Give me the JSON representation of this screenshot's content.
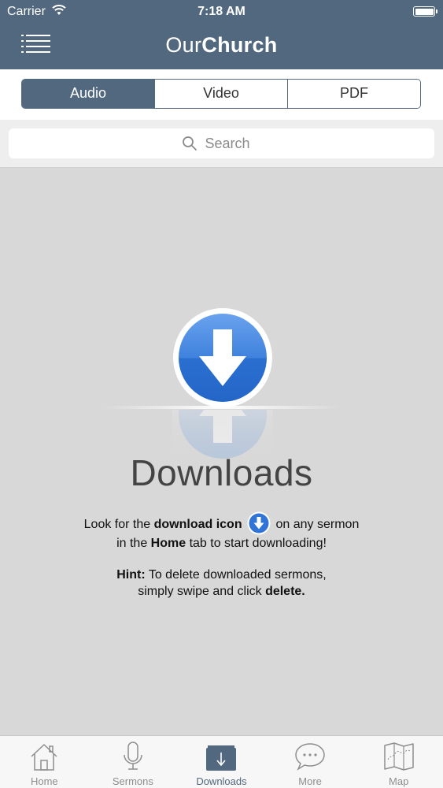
{
  "status_bar": {
    "carrier": "Carrier",
    "time": "7:18 AM"
  },
  "header": {
    "brand_light": "Our",
    "brand_bold": "Church"
  },
  "segments": [
    {
      "label": "Audio",
      "active": true
    },
    {
      "label": "Video",
      "active": false
    },
    {
      "label": "PDF",
      "active": false
    }
  ],
  "search": {
    "placeholder": "Search"
  },
  "empty_state": {
    "title": "Downloads",
    "line1_pre": "Look for the ",
    "line1_bold": "download icon",
    "line1_post": " on any sermon",
    "line2_pre": "in the ",
    "line2_bold": "Home",
    "line2_post": " tab to start downloading!",
    "hint_label": "Hint:",
    "hint_text": " To delete downloaded sermons,",
    "hint_line2_pre": "simply swipe and click ",
    "hint_line2_bold": "delete."
  },
  "tabs": [
    {
      "label": "Home",
      "icon": "home-icon"
    },
    {
      "label": "Sermons",
      "icon": "microphone-icon"
    },
    {
      "label": "Downloads",
      "icon": "download-box-icon",
      "active": true
    },
    {
      "label": "More",
      "icon": "chat-bubble-icon"
    },
    {
      "label": "Map",
      "icon": "map-icon"
    }
  ],
  "colors": {
    "accent": "#52687e",
    "icon_blue": "#2f74d6"
  }
}
